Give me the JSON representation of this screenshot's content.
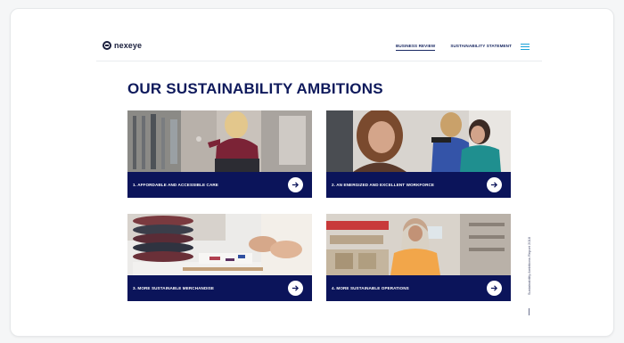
{
  "brand": {
    "name": "nexeye"
  },
  "nav": {
    "items": [
      {
        "label": "BUSINESS REVIEW",
        "active": true
      },
      {
        "label": "SUSTAINABILITY STATEMENT",
        "active": false
      }
    ],
    "menu_icon": "hamburger-menu-icon"
  },
  "page": {
    "heading": "OUR SUSTAINABILITY AMBITIONS",
    "side_text": "Sustainability Ambitions Report 2018"
  },
  "cards": [
    {
      "label": "1. AFFORDABLE AND ACCESSIBLE CARE",
      "icon": "arrow-right-icon"
    },
    {
      "label": "2. AN ENERGIZED AND EXCELLENT WORKFORCE",
      "icon": "arrow-right-icon"
    },
    {
      "label": "3. MORE SUSTAINABLE MERCHANDISE",
      "icon": "arrow-right-icon"
    },
    {
      "label": "4. MORE SUSTAINABLE OPERATIONS",
      "icon": "arrow-right-icon"
    }
  ],
  "colors": {
    "navy": "#0b145a",
    "heading": "#0f1a5c",
    "accent": "#1aa2d8"
  }
}
